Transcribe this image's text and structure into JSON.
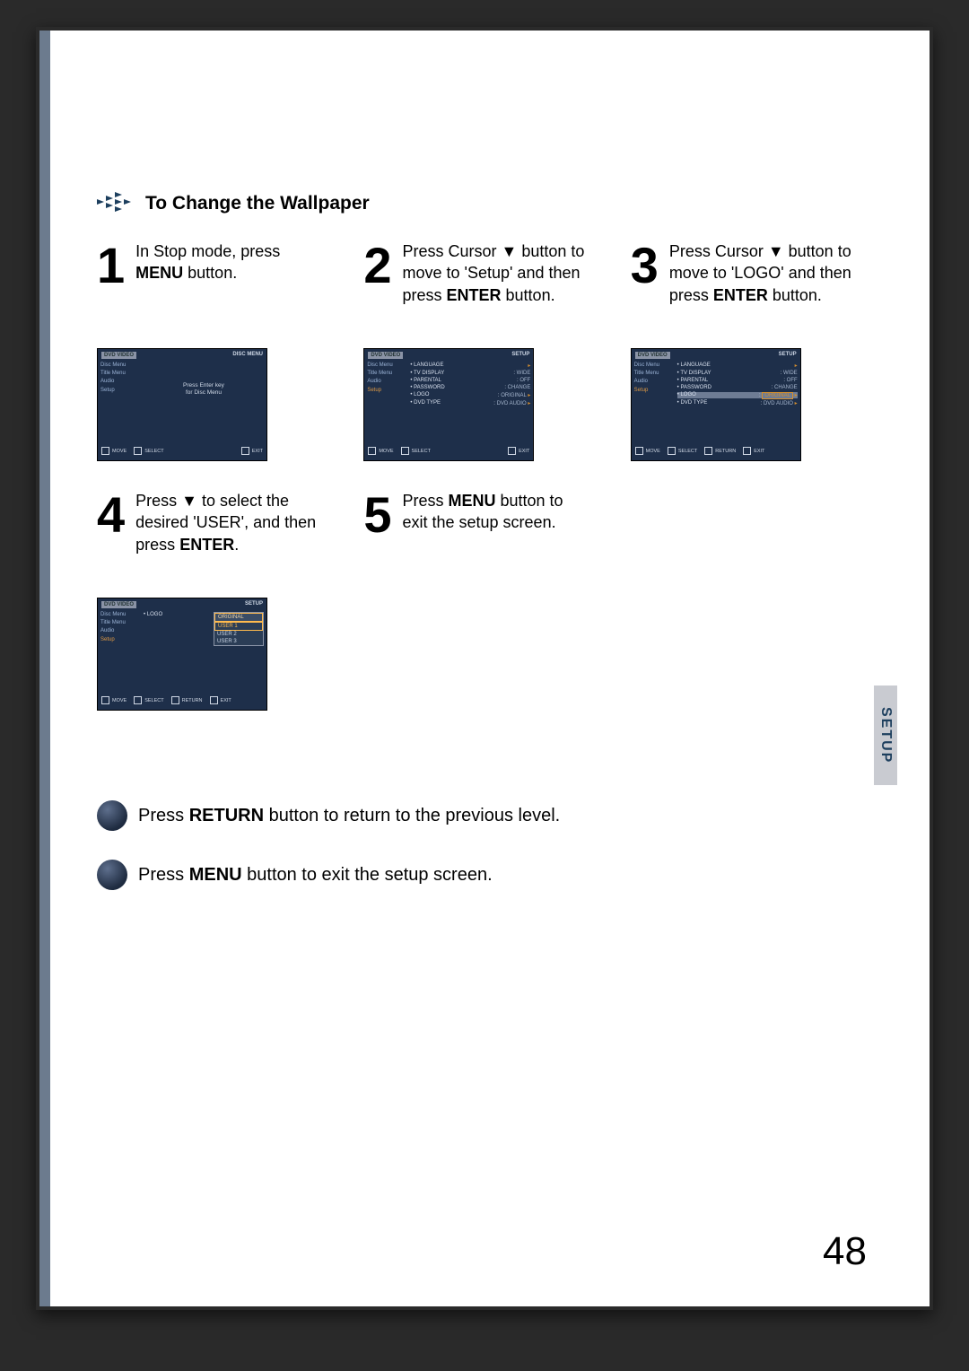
{
  "header": {
    "title": "To Change the Wallpaper"
  },
  "steps": [
    {
      "num": "1",
      "text_parts": [
        "In Stop mode, press ",
        "MENU",
        " button."
      ]
    },
    {
      "num": "2",
      "text_parts": [
        "Press Cursor ▼ button to move to 'Setup' and then press ",
        "ENTER",
        " button."
      ]
    },
    {
      "num": "3",
      "text_parts": [
        "Press Cursor ▼ button to move to 'LOGO' and then press ",
        "ENTER",
        " button."
      ]
    },
    {
      "num": "4",
      "text_parts": [
        "Press ▼ to select the desired 'USER', and then press ",
        "ENTER",
        "."
      ]
    },
    {
      "num": "5",
      "text_parts": [
        "Press ",
        "MENU",
        " button to exit the setup screen."
      ]
    }
  ],
  "shot1": {
    "top_left": "DVD VIDEO",
    "top_right": "DISC MENU",
    "side": [
      "Disc Menu",
      "Title Menu",
      "Audio",
      "Setup"
    ],
    "msg_l1": "Press Enter key",
    "msg_l2": "for Disc Menu",
    "legend": [
      "MOVE",
      "SELECT",
      "EXIT"
    ]
  },
  "shot2": {
    "top_left": "DVD VIDEO",
    "top_right": "SETUP",
    "side": [
      "Disc Menu",
      "Title Menu",
      "Audio",
      "Setup"
    ],
    "rows": [
      {
        "k": "LANGUAGE",
        "v": ""
      },
      {
        "k": "TV DISPLAY",
        "v": "WIDE"
      },
      {
        "k": "PARENTAL",
        "v": "OFF"
      },
      {
        "k": "PASSWORD",
        "v": "CHANGE"
      },
      {
        "k": "LOGO",
        "v": "ORIGINAL"
      },
      {
        "k": "DVD TYPE",
        "v": "DVD AUDIO"
      }
    ],
    "legend": [
      "MOVE",
      "SELECT",
      "EXIT"
    ]
  },
  "shot3": {
    "top_left": "DVD VIDEO",
    "top_right": "SETUP",
    "side": [
      "Disc Menu",
      "Title Menu",
      "Audio",
      "Setup"
    ],
    "rows": [
      {
        "k": "LANGUAGE",
        "v": ""
      },
      {
        "k": "TV DISPLAY",
        "v": "WIDE"
      },
      {
        "k": "PARENTAL",
        "v": "OFF"
      },
      {
        "k": "PASSWORD",
        "v": "CHANGE"
      },
      {
        "k": "LOGO",
        "v": "ORIGINAL",
        "sel": true
      },
      {
        "k": "DVD TYPE",
        "v": "DVD AUDIO"
      }
    ],
    "legend": [
      "MOVE",
      "SELECT",
      "RETURN",
      "EXIT"
    ]
  },
  "shot4": {
    "top_left": "DVD VIDEO",
    "top_right": "SETUP",
    "side": [
      "Disc Menu",
      "Title Menu",
      "Audio",
      "Setup"
    ],
    "rowk": "LOGO",
    "opts": [
      "ORIGINAL",
      "USER 1",
      "USER 2",
      "USER 3"
    ],
    "legend": [
      "MOVE",
      "SELECT",
      "RETURN",
      "EXIT"
    ]
  },
  "notes": [
    "Press RETURN button to return to the previous level.",
    "Press MENU button to exit the setup screen."
  ],
  "notes_bold": [
    "RETURN",
    "MENU"
  ],
  "side_tab": "SETUP",
  "page_number": "48"
}
